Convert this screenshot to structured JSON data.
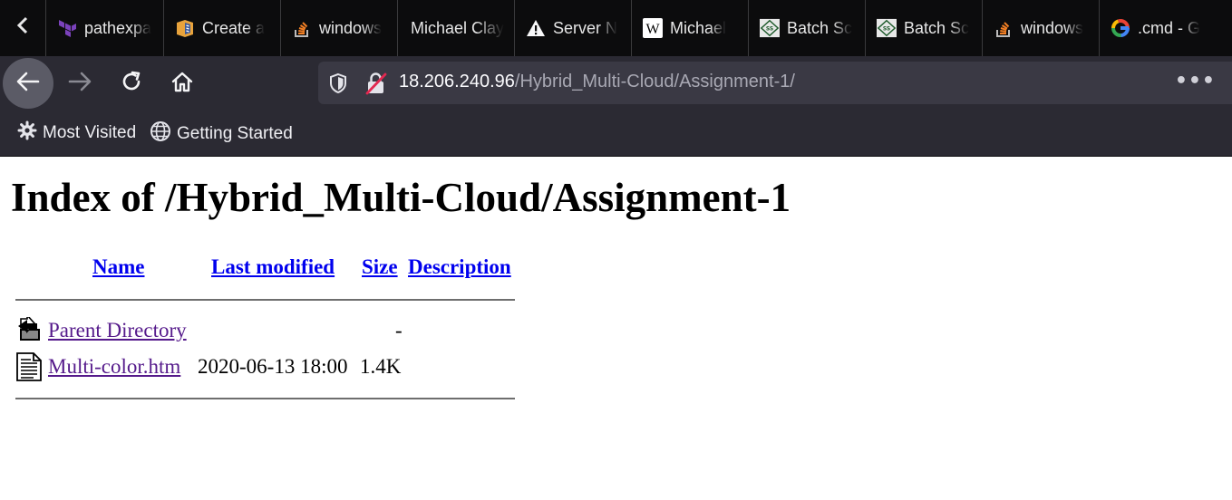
{
  "browser": {
    "tabs": [
      {
        "label": "pathexpa",
        "icon": "terraform-icon"
      },
      {
        "label": "Create a",
        "icon": "aws-box-icon"
      },
      {
        "label": "windows",
        "icon": "stackoverflow-icon"
      },
      {
        "label": "Michael Clay",
        "icon": ""
      },
      {
        "label": "Server N",
        "icon": "warning-icon"
      },
      {
        "label": "Michael",
        "icon": "wikipedia-icon"
      },
      {
        "label": "Batch Sc",
        "icon": "ss64-icon"
      },
      {
        "label": "Batch Sc",
        "icon": "ss64-icon"
      },
      {
        "label": "windows",
        "icon": "stackoverflow-icon"
      },
      {
        "label": ".cmd - G",
        "icon": "google-icon"
      }
    ],
    "url": {
      "host": "18.206.240.96",
      "path": "/Hybrid_Multi-Cloud/Assignment-1/"
    },
    "bookmarks": [
      {
        "label": "Most Visited",
        "icon": "gear-icon"
      },
      {
        "label": "Getting Started",
        "icon": "globe-icon"
      }
    ]
  },
  "page": {
    "title": "Index of /Hybrid_Multi-Cloud/Assignment-1",
    "columns": {
      "name": "Name",
      "last_modified": "Last modified",
      "size": "Size",
      "description": "Description"
    },
    "rows": [
      {
        "name": "Parent Directory",
        "modified": "",
        "size": "-",
        "description": "",
        "icon": "back-folder-icon"
      },
      {
        "name": "Multi-color.htm",
        "modified": "2020-06-13 18:00",
        "size": "1.4K",
        "description": "",
        "icon": "text-file-icon"
      }
    ]
  },
  "colors": {
    "link": "#0000ee",
    "visited_link": "#551a8b",
    "toolbar": "#2b2a33",
    "tabstrip": "#0c0c0d"
  }
}
